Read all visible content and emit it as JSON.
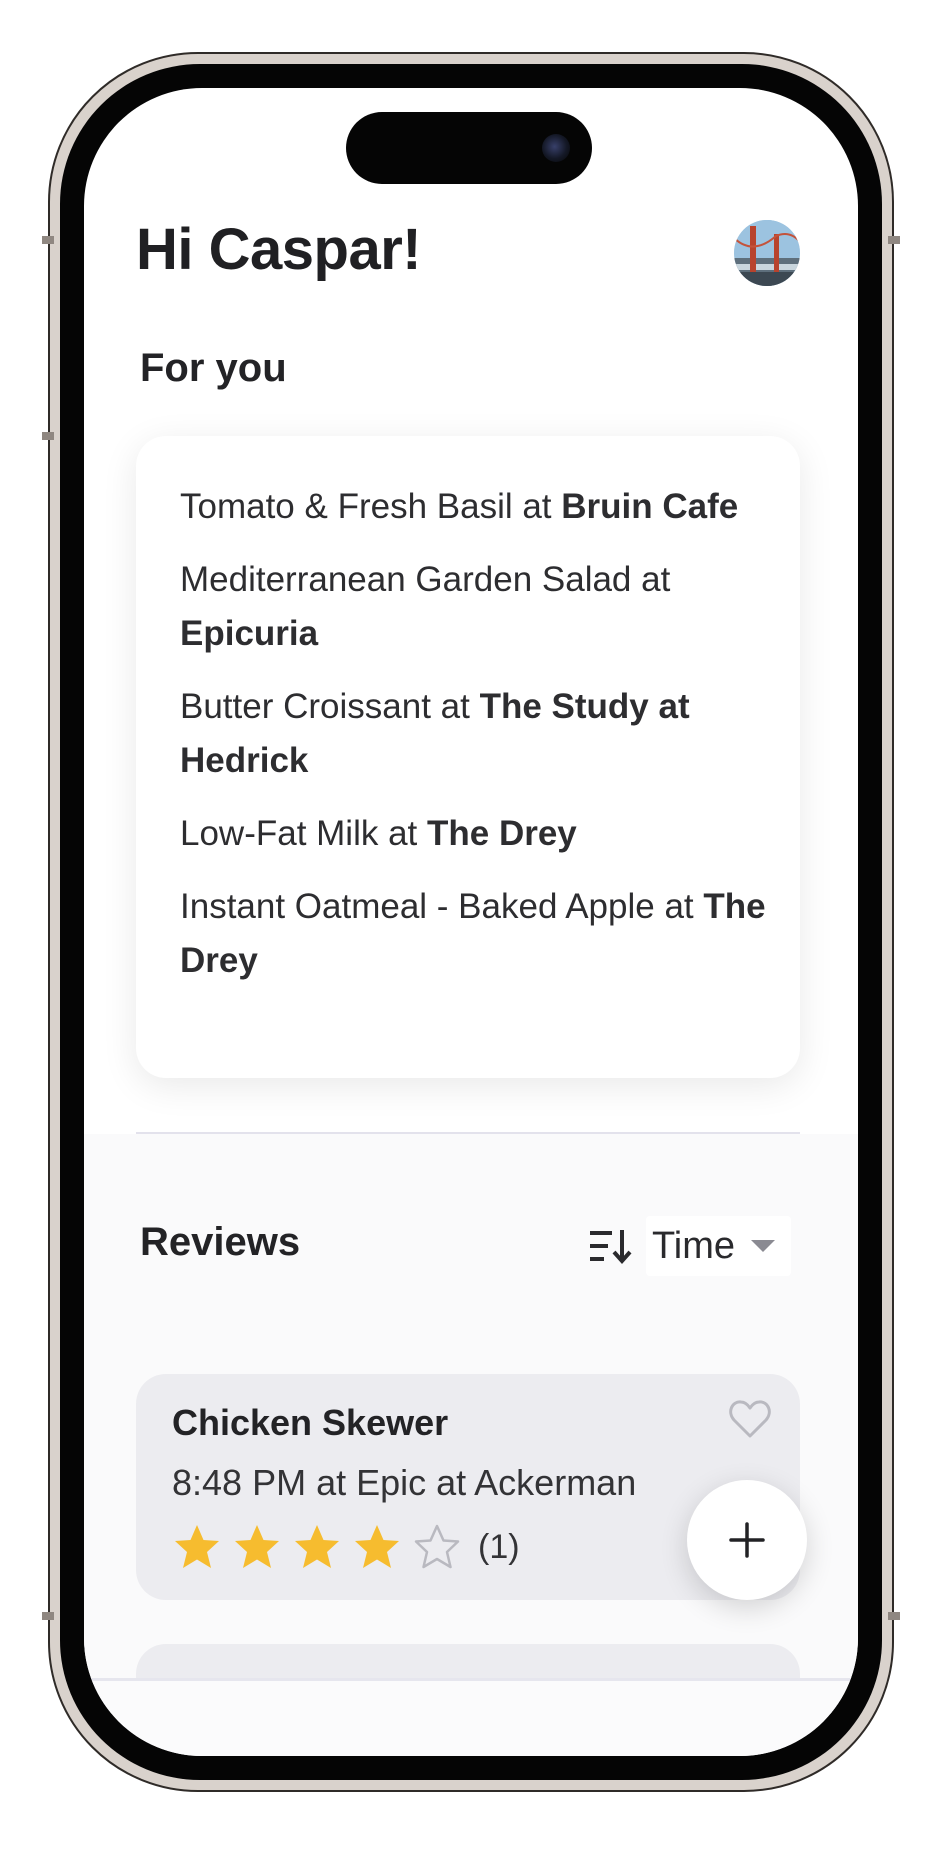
{
  "header": {
    "greeting": "Hi Caspar!",
    "avatar_icon": "golden-gate-bridge-photo"
  },
  "for_you": {
    "title": "For you",
    "items": [
      {
        "dish": "Tomato & Fresh Basil at ",
        "place": "Bruin Cafe"
      },
      {
        "dish": "Mediterranean Garden Salad at ",
        "place": "Epicuria"
      },
      {
        "dish": "Butter Croissant at ",
        "place": "The Study at Hedrick"
      },
      {
        "dish": "Low-Fat Milk at ",
        "place": "The Drey"
      },
      {
        "dish": "Instant Oatmeal - Baked Apple at ",
        "place": "The Drey"
      }
    ]
  },
  "reviews": {
    "title": "Reviews",
    "sort_icon": "sort-descending-icon",
    "sort_label": "Time",
    "items": [
      {
        "title": "Chicken Skewer",
        "meta": "8:48 PM at Epic at Ackerman",
        "rating": 4,
        "max_rating": 5,
        "count_label": "(1)",
        "favorite_icon": "heart-outline-icon"
      }
    ]
  },
  "fab": {
    "icon": "plus-icon"
  },
  "colors": {
    "star_filled": "#F6BC2F",
    "star_empty": "#B9B9C0",
    "text_primary": "#202023",
    "card_gray": "#ECECF0",
    "divider": "#E3E2EC"
  }
}
